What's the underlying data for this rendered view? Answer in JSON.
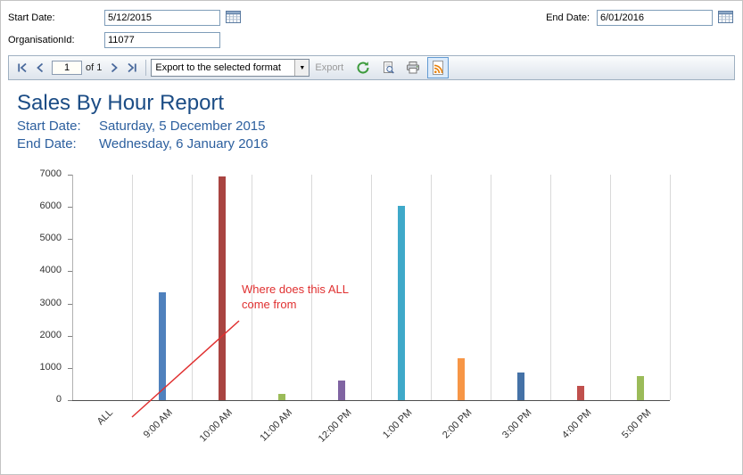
{
  "params": {
    "start_date_label": "Start Date:",
    "start_date_value": "5/12/2015",
    "end_date_label": "End Date:",
    "end_date_value": "6/01/2016",
    "organisation_label": "OrganisationId:",
    "organisation_value": "11077"
  },
  "toolbar": {
    "page_value": "1",
    "page_count_label": "of 1",
    "export_format_selected": "Export to the selected format",
    "export_link_label": "Export"
  },
  "icons": {
    "calendar": "grid-calendar",
    "first_page": "bar-chevron-left",
    "prev_page": "chevron-left",
    "next_page": "chevron-right",
    "last_page": "chevron-right-bar",
    "dropdown_arrow": "▼",
    "refresh": "green-circular-arrow",
    "print_layout": "page-with-magnifier",
    "printer": "printer",
    "data_feed": "page-with-feed-waves"
  },
  "report": {
    "title": "Sales By Hour Report",
    "start_date_label": "Start Date:",
    "start_date_value": "Saturday, 5 December 2015",
    "end_date_label": "End Date:",
    "end_date_value": "Wednesday, 6 January 2016"
  },
  "annotation": {
    "line1": "Where does this ALL",
    "line2": "come from",
    "color": "#e03030"
  },
  "chart_data": {
    "type": "bar",
    "title": "",
    "xlabel": "",
    "ylabel": "",
    "categories": [
      "ALL",
      "9:00 AM",
      "10:00 AM",
      "11:00 AM",
      "12:00 PM",
      "1:00 PM",
      "2:00 PM",
      "3:00 PM",
      "4:00 PM",
      "5:00 PM"
    ],
    "values": [
      0,
      3350,
      6950,
      200,
      620,
      6030,
      1300,
      860,
      440,
      760
    ],
    "colors": [
      "#4F81BD",
      "#4F81BD",
      "#A94441",
      "#9BBB59",
      "#8064A2",
      "#3FA9C9",
      "#F79646",
      "#4572A7",
      "#C0504D",
      "#9BBB59"
    ],
    "ylim": [
      0,
      7000
    ],
    "ytick_interval": 1000,
    "grid": "vertical",
    "legend": "none"
  }
}
